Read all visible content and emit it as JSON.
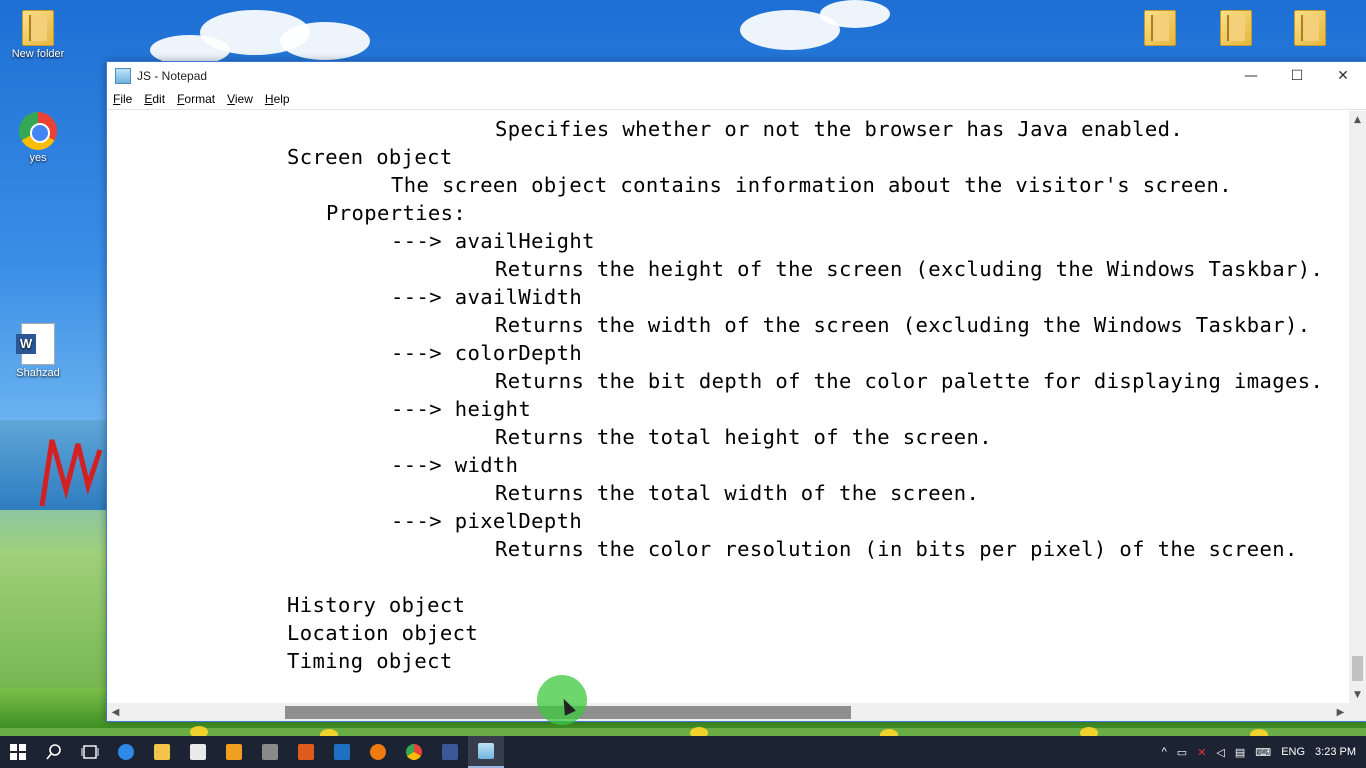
{
  "desktop": {
    "icons": [
      {
        "label": "New folder"
      },
      {
        "label": "yes"
      },
      {
        "label": "Shahzad"
      }
    ]
  },
  "window": {
    "title": "JS - Notepad",
    "controls": {
      "minimize": "—",
      "maximize": "☐",
      "close": "✕"
    }
  },
  "menu": {
    "items": [
      {
        "ul": "F",
        "rest": "ile"
      },
      {
        "ul": "E",
        "rest": "dit"
      },
      {
        "ul": "F",
        "rest": "ormat"
      },
      {
        "ul": "V",
        "rest": "iew"
      },
      {
        "ul": "H",
        "rest": "elp"
      }
    ]
  },
  "editor": {
    "lines": [
      "Specifies whether or not the browser has Java enabled.",
      "Screen object",
      "The screen object contains information about the visitor's screen.",
      "Properties:",
      "---> availHeight",
      "Returns the height of the screen (excluding the Windows Taskbar).",
      "---> availWidth",
      "Returns the width of the screen (excluding the Windows Taskbar).",
      "---> colorDepth",
      "Returns the bit depth of the color palette for displaying images.",
      "---> height",
      "Returns the total height of the screen.",
      "---> width",
      "Returns the total width of the screen.",
      "---> pixelDepth",
      "Returns the color resolution (in bits per pixel) of the screen.",
      "",
      "History object",
      "Location object",
      "Timing object"
    ]
  },
  "scrollbars": {
    "up": "▲",
    "down": "▼",
    "left": "◀",
    "right": "▶"
  },
  "taskbar": {
    "tray": {
      "language": "ENG",
      "time": "3:23 PM"
    }
  }
}
